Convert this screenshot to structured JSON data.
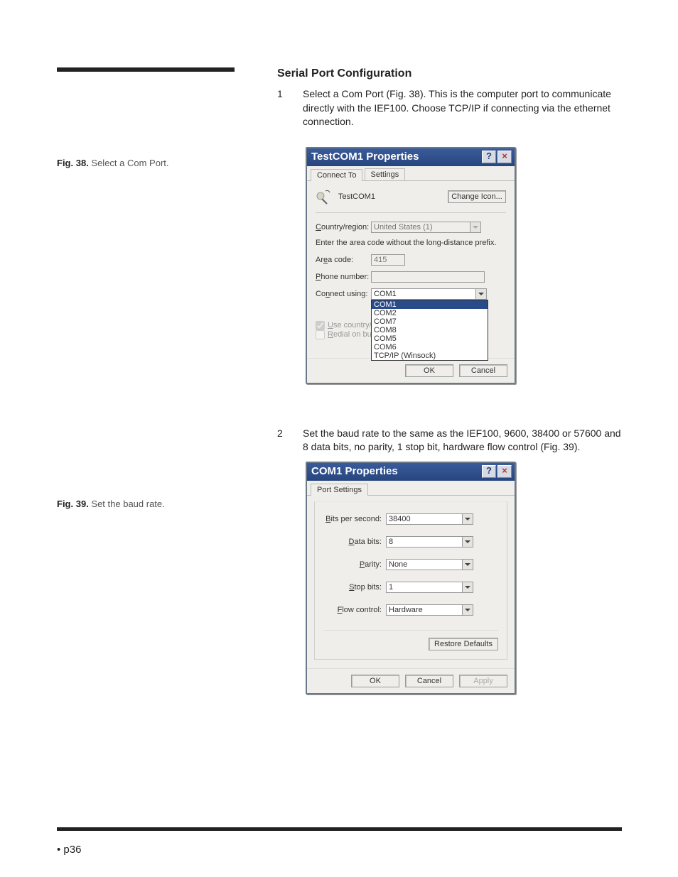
{
  "heading": "Serial Port Configuration",
  "step1_num": "1",
  "step1_text": "Select a Com Port (Fig. 38). This is the computer port to communicate directly with the IEF100. Choose TCP/IP if connecting via the ethernet connection.",
  "fig38_bold": "Fig. 38.",
  "fig38_text": " Select a Com Port.",
  "dlg1": {
    "title": "TestCOM1 Properties",
    "tab1": "Connect To",
    "tab2": "Settings",
    "iconname": "TestCOM1",
    "changebtn": "Change Icon...",
    "country_lbl": "Country/region:",
    "country_val": "United States (1)",
    "areacode_note": "Enter the area code without the long-distance prefix.",
    "areacode_lbl": "Area code:",
    "areacode_val": "415",
    "phone_lbl": "Phone number:",
    "connect_lbl": "Connect using:",
    "connect_val": "COM1",
    "opts": [
      "COM1",
      "COM2",
      "COM7",
      "COM8",
      "COM5",
      "COM6",
      "TCP/IP (Winsock)"
    ],
    "chk1": "Use country/",
    "chk2": "Redial on bu",
    "ok": "OK",
    "cancel": "Cancel"
  },
  "step2_num": "2",
  "step2_text": "Set the baud rate to the same as the IEF100, 9600, 38400 or 57600 and 8 data bits, no parity, 1 stop bit, hardware flow control (Fig. 39).",
  "fig39_bold": "Fig. 39.",
  "fig39_text": " Set the baud rate.",
  "dlg2": {
    "title": "COM1 Properties",
    "tab": "Port Settings",
    "bps_lbl": "Bits per second:",
    "bps_val": "38400",
    "db_lbl": "Data bits:",
    "db_val": "8",
    "par_lbl": "Parity:",
    "par_val": "None",
    "sb_lbl": "Stop bits:",
    "sb_val": "1",
    "fc_lbl": "Flow control:",
    "fc_val": "Hardware",
    "restore": "Restore Defaults",
    "ok": "OK",
    "cancel": "Cancel",
    "apply": "Apply"
  },
  "pageno": "• p36"
}
